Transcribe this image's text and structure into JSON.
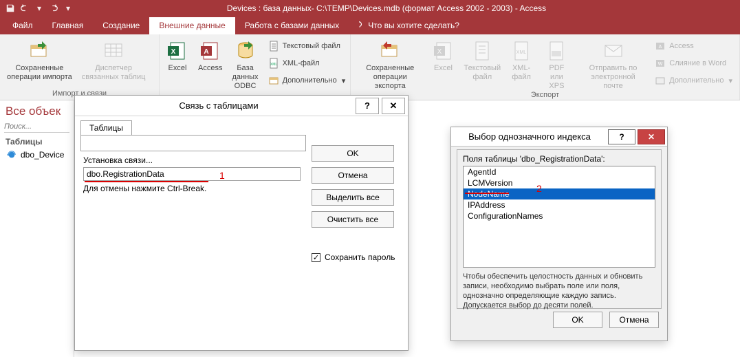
{
  "titlebar": {
    "title": "Devices : база данных- C:\\TEMP\\Devices.mdb (формат Access 2002 - 2003) - Access"
  },
  "tabs": {
    "file": "Файл",
    "home": "Главная",
    "create": "Создание",
    "external": "Внешние данные",
    "dbtools": "Работа с базами данных",
    "tellme": "Что вы хотите сделать?"
  },
  "ribbon": {
    "g1": {
      "savedimport": "Сохраненные\nоперации импорта",
      "linkedtable": "Диспетчер\nсвязанных таблиц",
      "label": "Импорт и связи"
    },
    "g2": {
      "excel": "Excel",
      "access": "Access",
      "odbc": "База данных\nODBC",
      "textfile": "Текстовый файл",
      "xmlfile": "XML-файл",
      "more": "Дополнительно"
    },
    "g3": {
      "savedexport": "Сохраненные\nоперации экспорта",
      "excel": "Excel",
      "text": "Текстовый\nфайл",
      "xml": "XML-\nфайл",
      "pdf": "PDF\nили XPS",
      "email": "Отправить по\nэлектронной почте",
      "access": "Access",
      "word": "Слияние в Word",
      "more": "Дополнительно",
      "label": "Экспорт"
    }
  },
  "nav": {
    "header": "Все объек",
    "search_ph": "Поиск...",
    "group": "Таблицы",
    "item": "dbo_Device"
  },
  "dlg1": {
    "title": "Связь с таблицами",
    "tab": "Таблицы",
    "link_label": "Установка связи...",
    "link_value": "dbo.RegistrationData",
    "cancel_hint": "Для отмены нажмите Ctrl-Break.",
    "ok": "OK",
    "cancel": "Отмена",
    "selectall": "Выделить все",
    "clearall": "Очистить все",
    "savepwd": "Сохранить пароль",
    "anno1": "1"
  },
  "dlg2": {
    "title": "Выбор однозначного индекса",
    "fields_label": "Поля таблицы 'dbo_RegistrationData':",
    "items": [
      "AgentId",
      "LCMVersion",
      "NodeName",
      "IPAddress",
      "ConfigurationNames"
    ],
    "selected_index": 2,
    "hint": "Чтобы обеспечить целостность данных и обновить записи, необходимо выбрать поле или поля, однозначно определяющие каждую запись. Допускается выбор до десяти полей.",
    "ok": "OK",
    "cancel": "Отмена",
    "anno2": "2"
  }
}
